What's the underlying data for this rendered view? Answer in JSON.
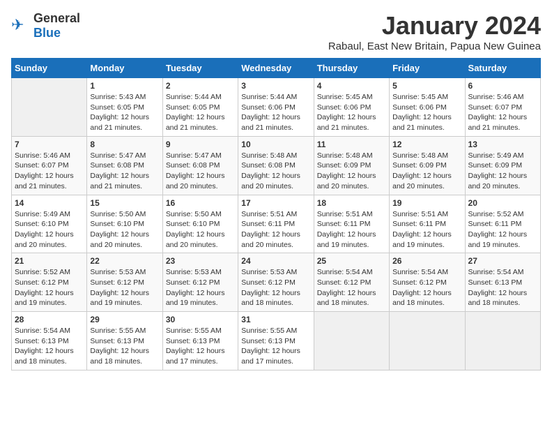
{
  "logo": {
    "general": "General",
    "blue": "Blue"
  },
  "title": "January 2024",
  "subtitle": "Rabaul, East New Britain, Papua New Guinea",
  "headers": [
    "Sunday",
    "Monday",
    "Tuesday",
    "Wednesday",
    "Thursday",
    "Friday",
    "Saturday"
  ],
  "weeks": [
    [
      {
        "day": "",
        "sunrise": "",
        "sunset": "",
        "daylight": "",
        "empty": true
      },
      {
        "day": "1",
        "sunrise": "Sunrise: 5:43 AM",
        "sunset": "Sunset: 6:05 PM",
        "daylight": "Daylight: 12 hours and 21 minutes.",
        "empty": false
      },
      {
        "day": "2",
        "sunrise": "Sunrise: 5:44 AM",
        "sunset": "Sunset: 6:05 PM",
        "daylight": "Daylight: 12 hours and 21 minutes.",
        "empty": false
      },
      {
        "day": "3",
        "sunrise": "Sunrise: 5:44 AM",
        "sunset": "Sunset: 6:06 PM",
        "daylight": "Daylight: 12 hours and 21 minutes.",
        "empty": false
      },
      {
        "day": "4",
        "sunrise": "Sunrise: 5:45 AM",
        "sunset": "Sunset: 6:06 PM",
        "daylight": "Daylight: 12 hours and 21 minutes.",
        "empty": false
      },
      {
        "day": "5",
        "sunrise": "Sunrise: 5:45 AM",
        "sunset": "Sunset: 6:06 PM",
        "daylight": "Daylight: 12 hours and 21 minutes.",
        "empty": false
      },
      {
        "day": "6",
        "sunrise": "Sunrise: 5:46 AM",
        "sunset": "Sunset: 6:07 PM",
        "daylight": "Daylight: 12 hours and 21 minutes.",
        "empty": false
      }
    ],
    [
      {
        "day": "7",
        "sunrise": "Sunrise: 5:46 AM",
        "sunset": "Sunset: 6:07 PM",
        "daylight": "Daylight: 12 hours and 21 minutes.",
        "empty": false
      },
      {
        "day": "8",
        "sunrise": "Sunrise: 5:47 AM",
        "sunset": "Sunset: 6:08 PM",
        "daylight": "Daylight: 12 hours and 21 minutes.",
        "empty": false
      },
      {
        "day": "9",
        "sunrise": "Sunrise: 5:47 AM",
        "sunset": "Sunset: 6:08 PM",
        "daylight": "Daylight: 12 hours and 20 minutes.",
        "empty": false
      },
      {
        "day": "10",
        "sunrise": "Sunrise: 5:48 AM",
        "sunset": "Sunset: 6:08 PM",
        "daylight": "Daylight: 12 hours and 20 minutes.",
        "empty": false
      },
      {
        "day": "11",
        "sunrise": "Sunrise: 5:48 AM",
        "sunset": "Sunset: 6:09 PM",
        "daylight": "Daylight: 12 hours and 20 minutes.",
        "empty": false
      },
      {
        "day": "12",
        "sunrise": "Sunrise: 5:48 AM",
        "sunset": "Sunset: 6:09 PM",
        "daylight": "Daylight: 12 hours and 20 minutes.",
        "empty": false
      },
      {
        "day": "13",
        "sunrise": "Sunrise: 5:49 AM",
        "sunset": "Sunset: 6:09 PM",
        "daylight": "Daylight: 12 hours and 20 minutes.",
        "empty": false
      }
    ],
    [
      {
        "day": "14",
        "sunrise": "Sunrise: 5:49 AM",
        "sunset": "Sunset: 6:10 PM",
        "daylight": "Daylight: 12 hours and 20 minutes.",
        "empty": false
      },
      {
        "day": "15",
        "sunrise": "Sunrise: 5:50 AM",
        "sunset": "Sunset: 6:10 PM",
        "daylight": "Daylight: 12 hours and 20 minutes.",
        "empty": false
      },
      {
        "day": "16",
        "sunrise": "Sunrise: 5:50 AM",
        "sunset": "Sunset: 6:10 PM",
        "daylight": "Daylight: 12 hours and 20 minutes.",
        "empty": false
      },
      {
        "day": "17",
        "sunrise": "Sunrise: 5:51 AM",
        "sunset": "Sunset: 6:11 PM",
        "daylight": "Daylight: 12 hours and 20 minutes.",
        "empty": false
      },
      {
        "day": "18",
        "sunrise": "Sunrise: 5:51 AM",
        "sunset": "Sunset: 6:11 PM",
        "daylight": "Daylight: 12 hours and 19 minutes.",
        "empty": false
      },
      {
        "day": "19",
        "sunrise": "Sunrise: 5:51 AM",
        "sunset": "Sunset: 6:11 PM",
        "daylight": "Daylight: 12 hours and 19 minutes.",
        "empty": false
      },
      {
        "day": "20",
        "sunrise": "Sunrise: 5:52 AM",
        "sunset": "Sunset: 6:11 PM",
        "daylight": "Daylight: 12 hours and 19 minutes.",
        "empty": false
      }
    ],
    [
      {
        "day": "21",
        "sunrise": "Sunrise: 5:52 AM",
        "sunset": "Sunset: 6:12 PM",
        "daylight": "Daylight: 12 hours and 19 minutes.",
        "empty": false
      },
      {
        "day": "22",
        "sunrise": "Sunrise: 5:53 AM",
        "sunset": "Sunset: 6:12 PM",
        "daylight": "Daylight: 12 hours and 19 minutes.",
        "empty": false
      },
      {
        "day": "23",
        "sunrise": "Sunrise: 5:53 AM",
        "sunset": "Sunset: 6:12 PM",
        "daylight": "Daylight: 12 hours and 19 minutes.",
        "empty": false
      },
      {
        "day": "24",
        "sunrise": "Sunrise: 5:53 AM",
        "sunset": "Sunset: 6:12 PM",
        "daylight": "Daylight: 12 hours and 18 minutes.",
        "empty": false
      },
      {
        "day": "25",
        "sunrise": "Sunrise: 5:54 AM",
        "sunset": "Sunset: 6:12 PM",
        "daylight": "Daylight: 12 hours and 18 minutes.",
        "empty": false
      },
      {
        "day": "26",
        "sunrise": "Sunrise: 5:54 AM",
        "sunset": "Sunset: 6:12 PM",
        "daylight": "Daylight: 12 hours and 18 minutes.",
        "empty": false
      },
      {
        "day": "27",
        "sunrise": "Sunrise: 5:54 AM",
        "sunset": "Sunset: 6:13 PM",
        "daylight": "Daylight: 12 hours and 18 minutes.",
        "empty": false
      }
    ],
    [
      {
        "day": "28",
        "sunrise": "Sunrise: 5:54 AM",
        "sunset": "Sunset: 6:13 PM",
        "daylight": "Daylight: 12 hours and 18 minutes.",
        "empty": false
      },
      {
        "day": "29",
        "sunrise": "Sunrise: 5:55 AM",
        "sunset": "Sunset: 6:13 PM",
        "daylight": "Daylight: 12 hours and 18 minutes.",
        "empty": false
      },
      {
        "day": "30",
        "sunrise": "Sunrise: 5:55 AM",
        "sunset": "Sunset: 6:13 PM",
        "daylight": "Daylight: 12 hours and 17 minutes.",
        "empty": false
      },
      {
        "day": "31",
        "sunrise": "Sunrise: 5:55 AM",
        "sunset": "Sunset: 6:13 PM",
        "daylight": "Daylight: 12 hours and 17 minutes.",
        "empty": false
      },
      {
        "day": "",
        "sunrise": "",
        "sunset": "",
        "daylight": "",
        "empty": true
      },
      {
        "day": "",
        "sunrise": "",
        "sunset": "",
        "daylight": "",
        "empty": true
      },
      {
        "day": "",
        "sunrise": "",
        "sunset": "",
        "daylight": "",
        "empty": true
      }
    ]
  ]
}
